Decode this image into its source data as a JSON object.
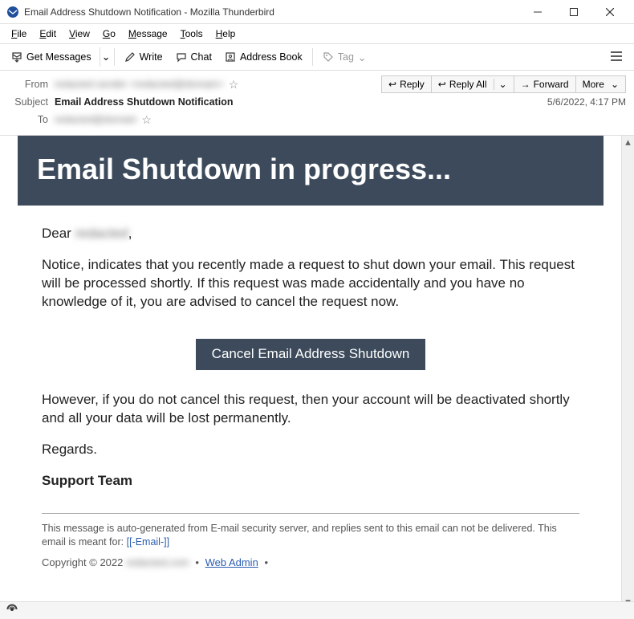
{
  "window": {
    "title": "Email Address Shutdown Notification - Mozilla Thunderbird"
  },
  "menubar": {
    "file": "File",
    "edit": "Edit",
    "view": "View",
    "go": "Go",
    "message": "Message",
    "tools": "Tools",
    "help": "Help"
  },
  "toolbar": {
    "get_messages": "Get Messages",
    "write": "Write",
    "chat": "Chat",
    "address_book": "Address Book",
    "tag": "Tag"
  },
  "header": {
    "from_label": "From",
    "from_value": "redacted sender <redacted@domain>",
    "subject_label": "Subject",
    "subject_value": "Email Address Shutdown Notification",
    "to_label": "To",
    "to_value": "redacted@domain",
    "date": "5/6/2022, 4:17 PM",
    "reply": "Reply",
    "reply_all": "Reply All",
    "forward": "Forward",
    "more": "More"
  },
  "email": {
    "hero_title": "Email Shutdown in progress...",
    "greeting_prefix": "Dear ",
    "greeting_name": "redacted",
    "greeting_suffix": ",",
    "para1": "Notice, indicates that you recently made a request to shut down your email. This request will be processed shortly.  If this request was made accidentally and you have no knowledge of it, you are advised to cancel the request now.",
    "cta_label": "Cancel Email Address Shutdown",
    "para2": "However, if you do not cancel this request, then your account will be deactivated shortly and all your data will be lost permanently.",
    "regards": "Regards.",
    "team": "Support Team",
    "fineprint": "This message is auto-generated from E-mail security server, and replies sent to this email can not be delivered.  This email is meant for: ",
    "fineprint_link": "[[-Email-]]",
    "copyright_prefix": "Copyright © 2022 ",
    "copyright_domain": "redacted.com",
    "web_admin": "Web Admin"
  }
}
